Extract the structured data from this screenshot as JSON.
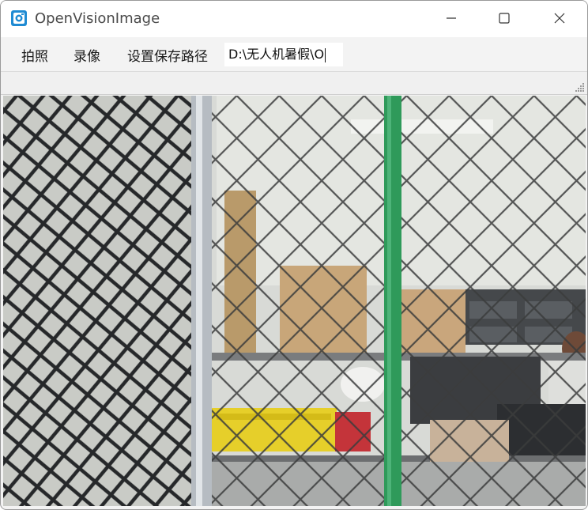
{
  "window": {
    "title": "OpenVisionImage"
  },
  "toolbar": {
    "photo_label": "拍照",
    "video_label": "录像",
    "set_path_label": "设置保存路径",
    "path_value": "D:\\无人机暑假\\O"
  },
  "icons": {
    "app": "app-camera-icon",
    "minimize": "minimize-icon",
    "maximize": "maximize-icon",
    "close": "close-icon",
    "resize": "resize-grip-icon"
  },
  "colors": {
    "accent": "#1f8bd3",
    "pole": "#2f9a5a",
    "box_yellow": "#e6cf2a"
  }
}
